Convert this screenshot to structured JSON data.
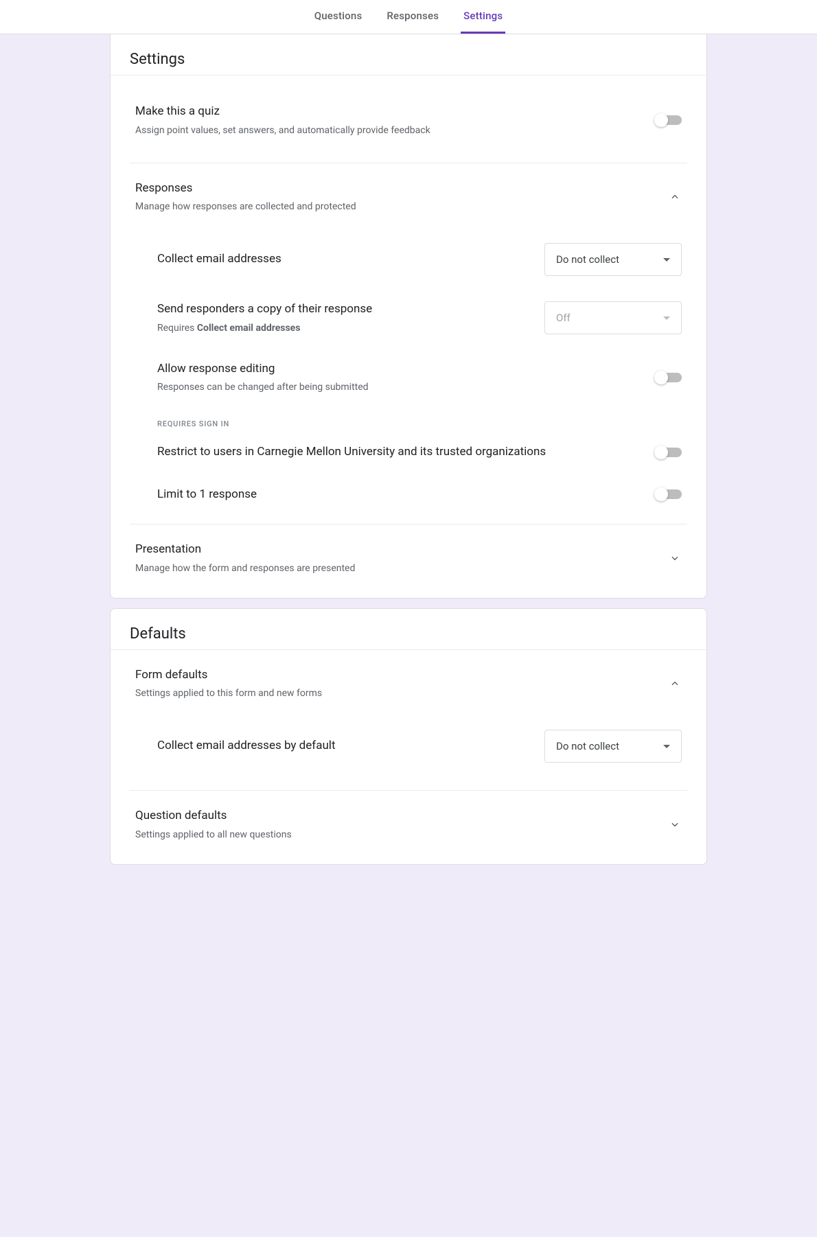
{
  "tabs": {
    "questions": "Questions",
    "responses": "Responses",
    "settings": "Settings"
  },
  "settingsCard": {
    "title": "Settings",
    "quiz": {
      "title": "Make this a quiz",
      "sub": "Assign point values, set answers, and automatically provide feedback"
    },
    "responses": {
      "title": "Responses",
      "sub": "Manage how responses are collected and protected",
      "collectEmail": {
        "label": "Collect email addresses",
        "value": "Do not collect"
      },
      "sendCopy": {
        "label": "Send responders a copy of their response",
        "reqPrefix": "Requires ",
        "reqBold": "Collect email addresses",
        "value": "Off"
      },
      "allowEdit": {
        "label": "Allow response editing",
        "sub": "Responses can be changed after being submitted"
      },
      "signInHeader": "REQUIRES SIGN IN",
      "restrict": {
        "label": "Restrict to users in Carnegie Mellon University and its trusted organizations"
      },
      "limitOne": {
        "label": "Limit to 1 response"
      }
    },
    "presentation": {
      "title": "Presentation",
      "sub": "Manage how the form and responses are presented"
    }
  },
  "defaultsCard": {
    "title": "Defaults",
    "formDefaults": {
      "title": "Form defaults",
      "sub": "Settings applied to this form and new forms",
      "collectDefault": {
        "label": "Collect email addresses by default",
        "value": "Do not collect"
      }
    },
    "questionDefaults": {
      "title": "Question defaults",
      "sub": "Settings applied to all new questions"
    }
  }
}
